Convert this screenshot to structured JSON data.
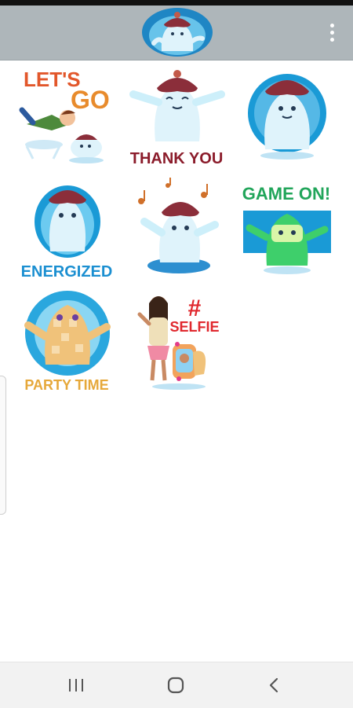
{
  "header": {
    "avatar_icon": "mascot-avatar-icon",
    "menu_icon": "more-vert-icon"
  },
  "stickers": [
    {
      "text": [
        "LET'S",
        "GO"
      ],
      "colors": [
        "#e2572b",
        "#e88b2c"
      ]
    },
    {
      "text": [
        "THANK YOU"
      ],
      "colors": [
        "#8b1c2b"
      ]
    },
    {
      "text": [],
      "colors": [
        "#1a9ad6"
      ]
    },
    {
      "text": [
        "ENERGIZED"
      ],
      "colors": [
        "#1b8fd1"
      ]
    },
    {
      "text": [],
      "colors": [
        "#d0702a"
      ]
    },
    {
      "text": [
        "GAME ON!"
      ],
      "colors": [
        "#21a55a"
      ]
    },
    {
      "text": [
        "PARTY TIME"
      ],
      "colors": [
        "#e6a83a"
      ]
    },
    {
      "text": [
        "#",
        "SELFIE"
      ],
      "colors": [
        "#e0282e"
      ]
    }
  ],
  "navbar": {
    "recents_icon": "recents-icon",
    "home_icon": "home-icon",
    "back_icon": "back-icon"
  }
}
